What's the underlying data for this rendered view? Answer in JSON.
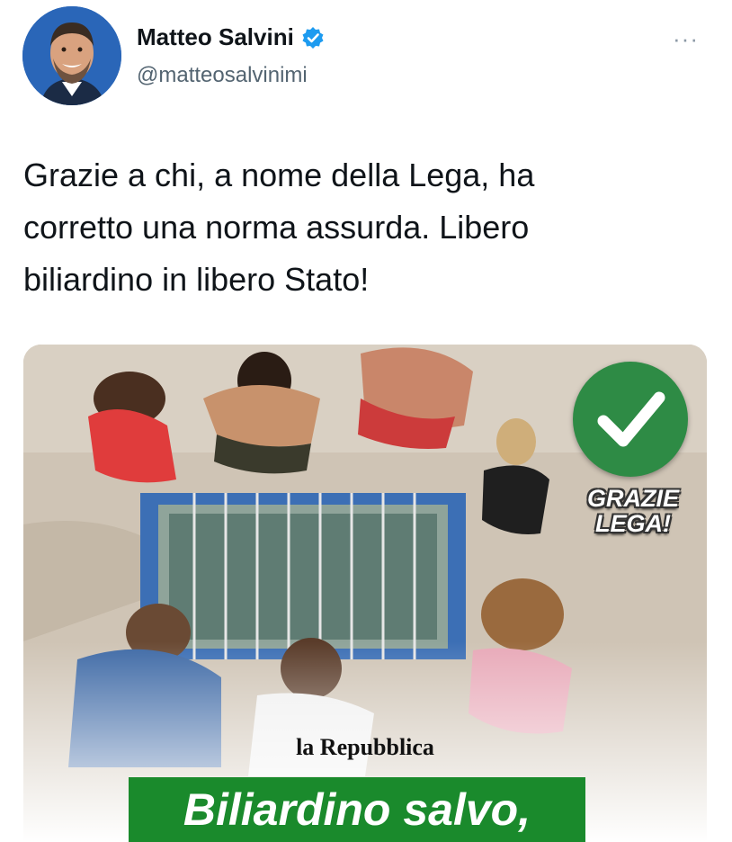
{
  "author": {
    "name": "Matteo Salvini",
    "handle": "@matteosalvinimi",
    "verified": true
  },
  "more_label": "···",
  "tweet": {
    "lines": [
      "Grazie a chi, a nome della Lega, ha",
      "corretto una norma assurda. Libero",
      "biliardino in libero Stato!"
    ]
  },
  "media": {
    "badge_line1": "GRAZIE",
    "badge_line2": "LEGA!",
    "source": "la Repubblica",
    "headline": "Biliardino salvo,"
  },
  "colors": {
    "verified_blue": "#1d9bf0",
    "badge_green": "#2e8b45",
    "headline_green": "#1a8a2c"
  },
  "icons": {
    "verified": "verified-badge-icon",
    "check": "check-mark-icon",
    "more": "more-options-icon"
  }
}
